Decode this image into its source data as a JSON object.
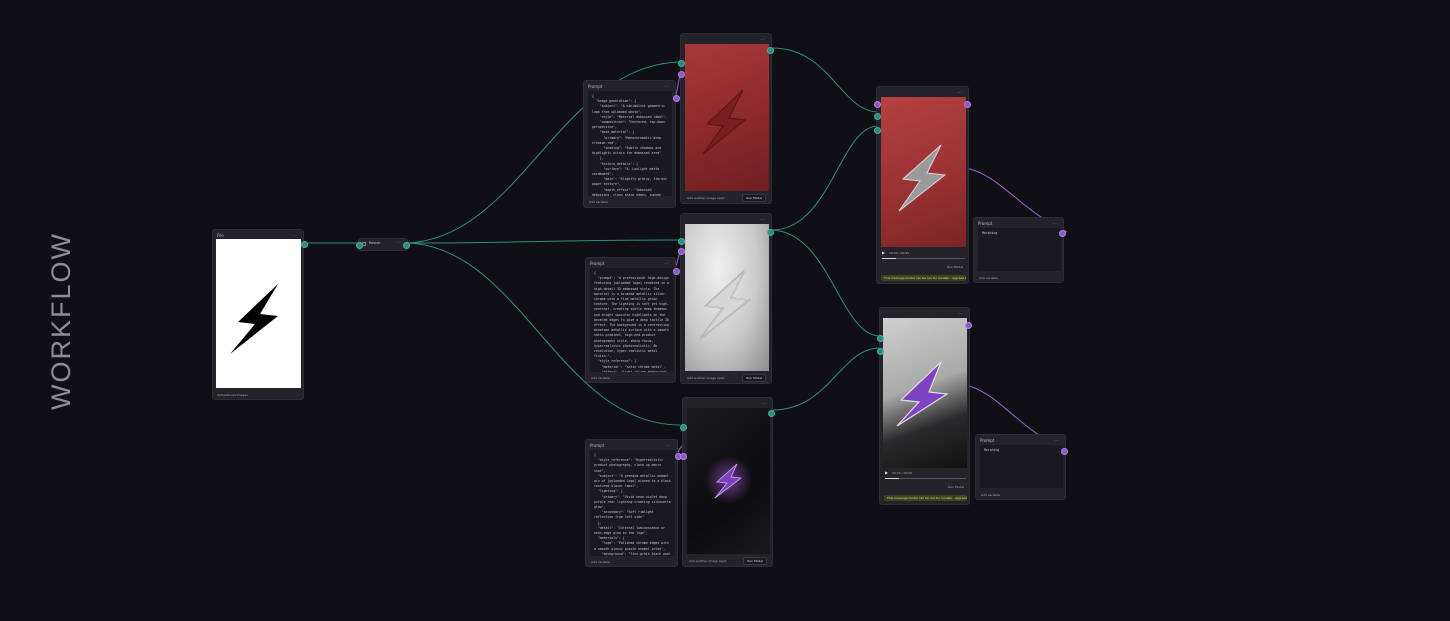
{
  "workflow_title": "WORKFLOW",
  "colors": {
    "background": "#100f14",
    "node": "#24232a",
    "wire_teal": "#2f8f7e",
    "wire_purple": "#9a63d6"
  },
  "file_node": {
    "title": "File",
    "footer": "Upload/Load Images"
  },
  "resize_node": {
    "title": "Resize"
  },
  "prompt_nodes": [
    {
      "title": "Prompt",
      "footer": "Add variable",
      "text": "{\n  \"image_generation\": {\n    \"subject\": \"A minimalist geometric logo from uploaded photo\",\n    \"style\": \"Material debossed label\",\n    \"composition\": \"Centered, top-down perspective\",\n    \"base_material\": {\n      \"primary\": \"Monochromatic deep crimson red\",\n      \"shading\": \"Subtle shadows and highlights within the debossed area\"\n    },\n    \"texture_details\": {\n      \"surface\": \"A. Lowlight matte cardboard\",\n      \"main\": \"Slightly grainy, fibrous paper texture\",\n      \"depth_effect\": \"Imbossed debossing, clean sharp edges, sunken into the paper\"\n    },\n    \"lighting\": \"Soft, directional studio lighting to emphasize the 3D indentation\"\n  }\n}"
    },
    {
      "title": "Prompt",
      "footer": "Add variable",
      "text": "{\n  \"prompt\": \"A professional high-design featuring [uploaded logo] rendered in a high-detail 3D embossed style. The material is a brushed metallic silver-chrome with a fine metallic grain texture. The lighting is soft yet high-contrast, creating subtle deep shadows and bright specular highlights on the beveled edges to give a deep tactile 3D effect. The background is a contrasting monotone metallic surface with a smooth satin gradient, high-end product photography style, sharp focus, hyperrealistic photorealistic, 8k resolution, hyper-realistic metal finish.\",\n  \"style_reference\": {\n    \"material\": \"satin chrome metal\",\n    \"effect\": \"tight inline embossing\",\n    \"lighting\": \"soft studio lighting with mirror window\",\n    \"color_palette\": \"monochrome/silver greyscale\"\n  },\n  \"technical_parameters\": {\n}"
    },
    {
      "title": "Prompt",
      "footer": "Add variable",
      "text": "{\n  \"style_reference\": \"Hyperrealistic product photography, close-up macro shot\",\n  \"subject\": \"A premium metallic enamel pin of [uploaded logo] pinned to a black textured blazer lapel\",\n  \"lighting\": {\n    \"primary\": \"Vivid neon-violet deep purple rear lighting creating silhouette glow\",\n    \"secondary\": \"Soft rimlight reflection from left side\"\n  },\n  \"detail\": \"Internal luminescence or neon-edge glow on the logo\",\n  \"materials\": {\n    \"logo\": \"Polished chrome edges with a smooth glossy purple enamel inlay\",\n    \"background\": \"Fine-grain black wool or felt suit fabric with visible fiber texture\",\n    \"accent\": \"Glossy, clean metallic reflections\"\n  }\n}"
    }
  ],
  "image_nodes": [
    {
      "footer": "Add another image input",
      "run": "Run Model"
    },
    {
      "footer": "Add another image input",
      "run": "Run Model"
    },
    {
      "footer": "Add another image input",
      "run": "Run Model"
    }
  ],
  "video_nodes": [
    {
      "time": "00:00 / 00:05",
      "run": "Run Model",
      "warning": "This message model can be run for models · upgrade to get more credits"
    },
    {
      "time": "00:00 / 00:05",
      "run": "Run Model",
      "warning": "This message model can be run for models · upgrade to get more credits"
    }
  ],
  "morph_prompts": [
    {
      "title": "Prompt",
      "text": "Morphing",
      "footer": "Add variable"
    },
    {
      "title": "Prompt",
      "text": "Morphing",
      "footer": "Add variable"
    }
  ]
}
